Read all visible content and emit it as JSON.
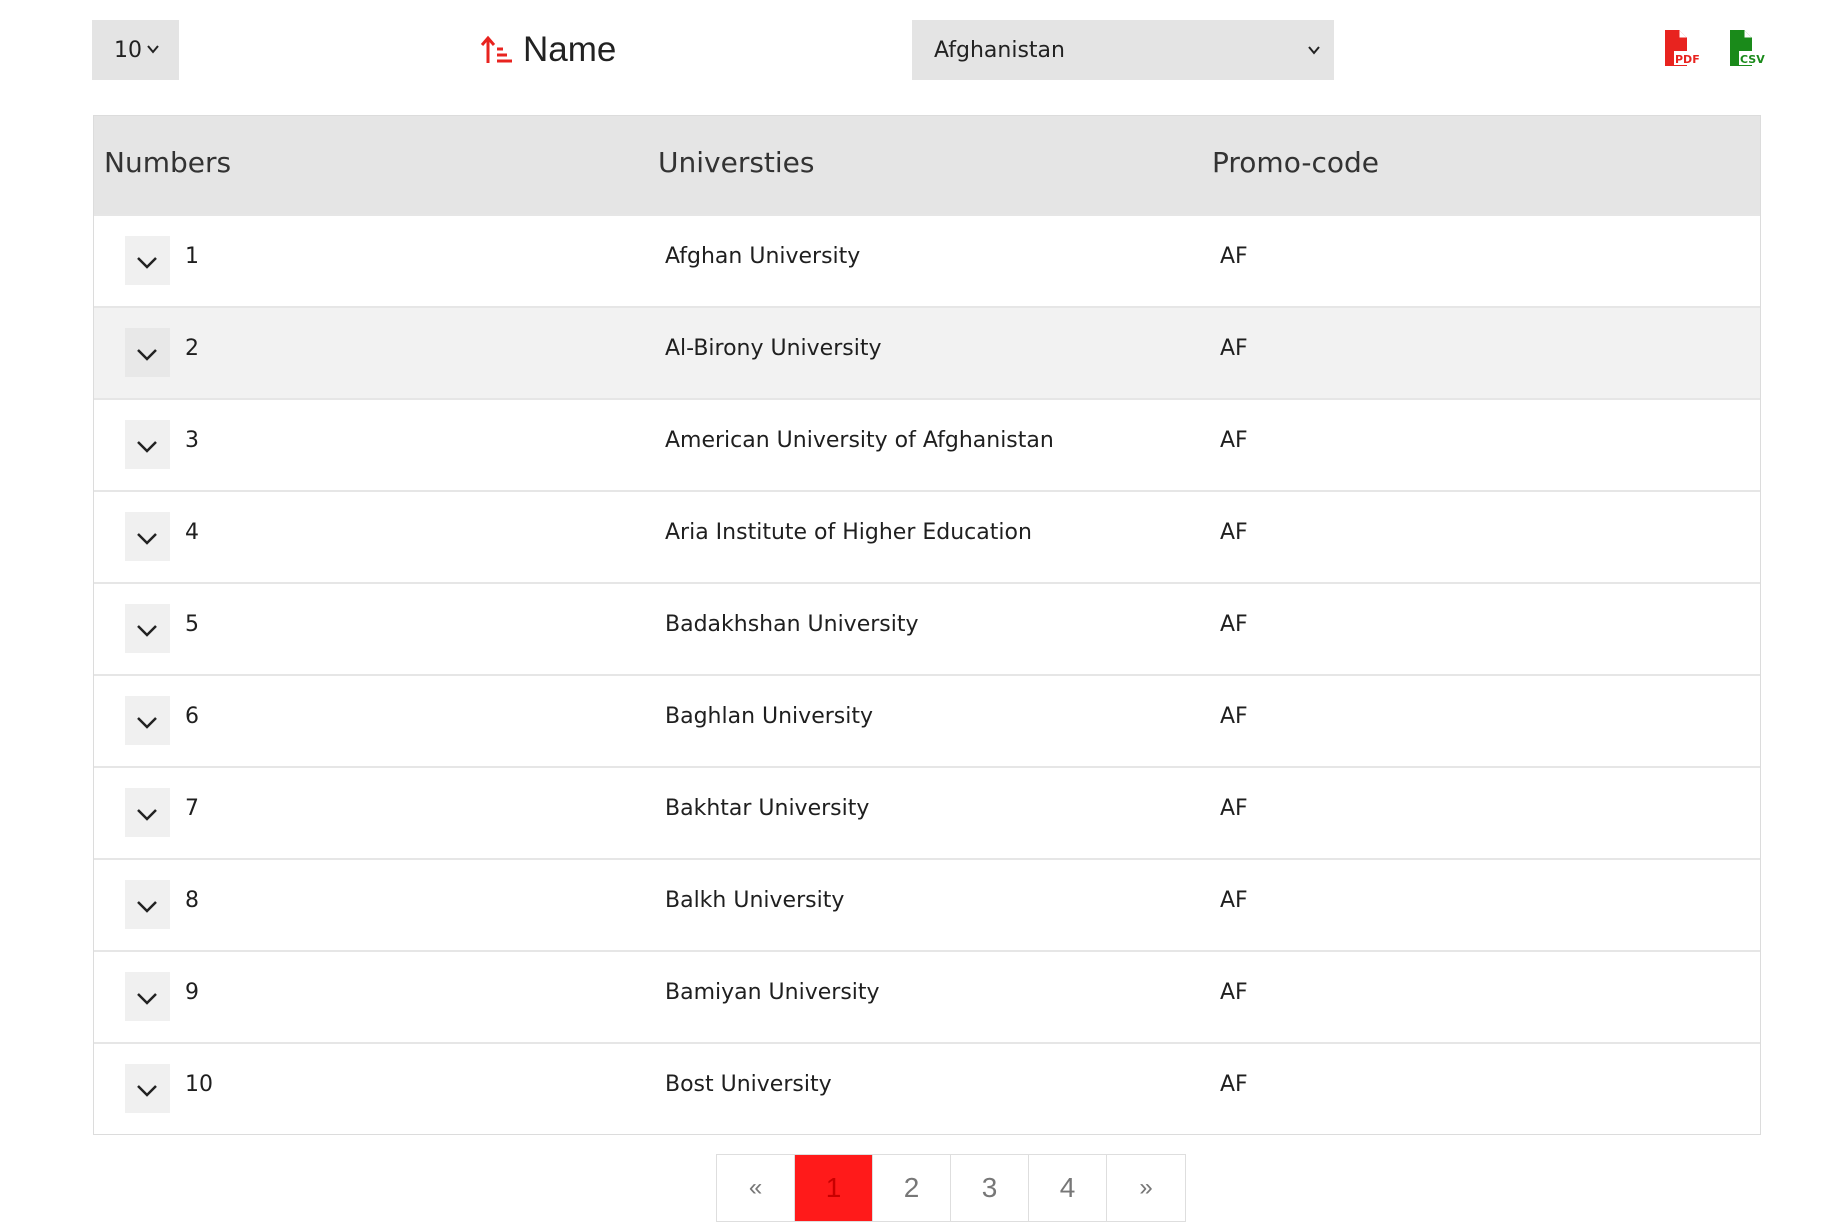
{
  "toolbar": {
    "page_size": "10",
    "sort_label": "Name",
    "country_selected": "Afghanistan",
    "export_pdf_label": "PDF",
    "export_csv_label": "CSV"
  },
  "colors": {
    "accent": "#ff1a1a",
    "pdf": "#e8231f",
    "csv": "#1a8a1a",
    "header_bg": "#e5e5e5",
    "alt_row_bg": "#f2f2f2"
  },
  "icons": {
    "sort": "sort-ascending-icon",
    "expand": "chevron-down-icon",
    "pdf": "pdf-file-icon",
    "csv": "csv-file-icon"
  },
  "table": {
    "columns": [
      "Numbers",
      "Universties",
      "Promo-code"
    ],
    "rows": [
      {
        "number": "1",
        "university": "Afghan University",
        "promo": "AF"
      },
      {
        "number": "2",
        "university": "Al-Birony University",
        "promo": "AF"
      },
      {
        "number": "3",
        "university": "American University of Afghanistan",
        "promo": "AF"
      },
      {
        "number": "4",
        "university": "Aria Institute of Higher Education",
        "promo": "AF"
      },
      {
        "number": "5",
        "university": "Badakhshan University",
        "promo": "AF"
      },
      {
        "number": "6",
        "university": "Baghlan University",
        "promo": "AF"
      },
      {
        "number": "7",
        "university": "Bakhtar University",
        "promo": "AF"
      },
      {
        "number": "8",
        "university": "Balkh University",
        "promo": "AF"
      },
      {
        "number": "9",
        "university": "Bamiyan University",
        "promo": "AF"
      },
      {
        "number": "10",
        "university": "Bost University",
        "promo": "AF"
      }
    ]
  },
  "pagination": {
    "prev": "«",
    "pages": [
      "1",
      "2",
      "3",
      "4"
    ],
    "active": "1",
    "next": "»"
  }
}
